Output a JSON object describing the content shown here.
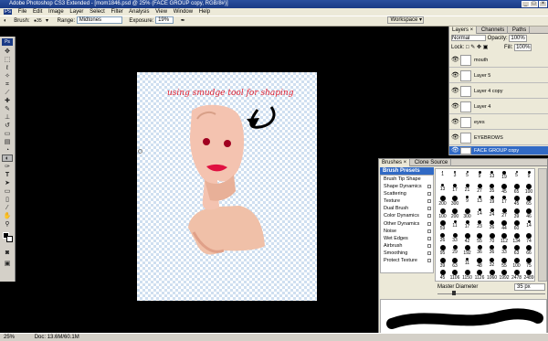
{
  "window": {
    "title": "Adobe Photoshop CS3 Extended - [mom1846.psd @ 25% (FACE GROUP copy, RGB/8#)]"
  },
  "menu": [
    "File",
    "Edit",
    "Image",
    "Layer",
    "Select",
    "Filter",
    "Analysis",
    "View",
    "Window",
    "Help"
  ],
  "options": {
    "brush_label": "Brush:",
    "brush_size": "35",
    "range_label": "Range:",
    "range_value": "Midtones",
    "exposure_label": "Exposure:",
    "exposure_value": "19%",
    "workspace_label": "Workspace ▾"
  },
  "canvas": {
    "caption": "using smudge tool for shaping"
  },
  "status": {
    "zoom": "25%",
    "doc": "Doc: 13.6M/60.1M"
  },
  "layers_panel": {
    "tabs": [
      "Layers ×",
      "Channels",
      "Paths"
    ],
    "blend_mode": "Normal",
    "opacity_label": "Opacity:",
    "opacity_value": "100%",
    "lock_label": "Lock:",
    "fill_label": "Fill:",
    "fill_value": "100%",
    "layers": [
      "mouth",
      "Layer 5",
      "Layer 4 copy",
      "Layer 4",
      "eyes",
      "EYEBROWS",
      "FACE GROUP copy"
    ],
    "selected": "FACE GROUP copy"
  },
  "brushes_panel": {
    "tabs": [
      "Brushes ×",
      "Clone Source"
    ],
    "items": [
      {
        "label": "Brush Presets",
        "lock": false
      },
      {
        "label": "Brush Tip Shape",
        "lock": false
      },
      {
        "label": "Shape Dynamics",
        "lock": true
      },
      {
        "label": "Scattering",
        "lock": true
      },
      {
        "label": "Texture",
        "lock": true
      },
      {
        "label": "Dual Brush",
        "lock": true
      },
      {
        "label": "Color Dynamics",
        "lock": true
      },
      {
        "label": "Other Dynamics",
        "lock": true
      },
      {
        "label": "Noise",
        "lock": true
      },
      {
        "label": "Wet Edges",
        "lock": true
      },
      {
        "label": "Airbrush",
        "lock": true
      },
      {
        "label": "Smoothing",
        "lock": true
      },
      {
        "label": "Protect Texture",
        "lock": true
      }
    ],
    "grid_sizes": [
      "1",
      "3",
      "5",
      "9",
      "13",
      "19",
      "5",
      "9",
      "13",
      "17",
      "21",
      "27",
      "35",
      "45",
      "65",
      "100",
      "200",
      "300",
      "9",
      "13",
      "19",
      "17",
      "45",
      "65",
      "100",
      "200",
      "300",
      "14",
      "24",
      "27",
      "39",
      "46",
      "59",
      "11",
      "17",
      "23",
      "36",
      "44",
      "60",
      "14",
      "26",
      "33",
      "42",
      "55",
      "70",
      "112",
      "134",
      "74",
      "95",
      "29",
      "192",
      "36",
      "36",
      "33",
      "63",
      "66",
      "39",
      "63",
      "11",
      "48",
      "32",
      "55",
      "100",
      "75",
      "45",
      "1106",
      "1150",
      "1126",
      "1060",
      "1992",
      "2478",
      "2489"
    ],
    "master_diameter_label": "Master Diameter",
    "master_diameter_value": "35 px"
  },
  "colors": {
    "accent": "#316ac5",
    "caption_red": "#e02030"
  }
}
